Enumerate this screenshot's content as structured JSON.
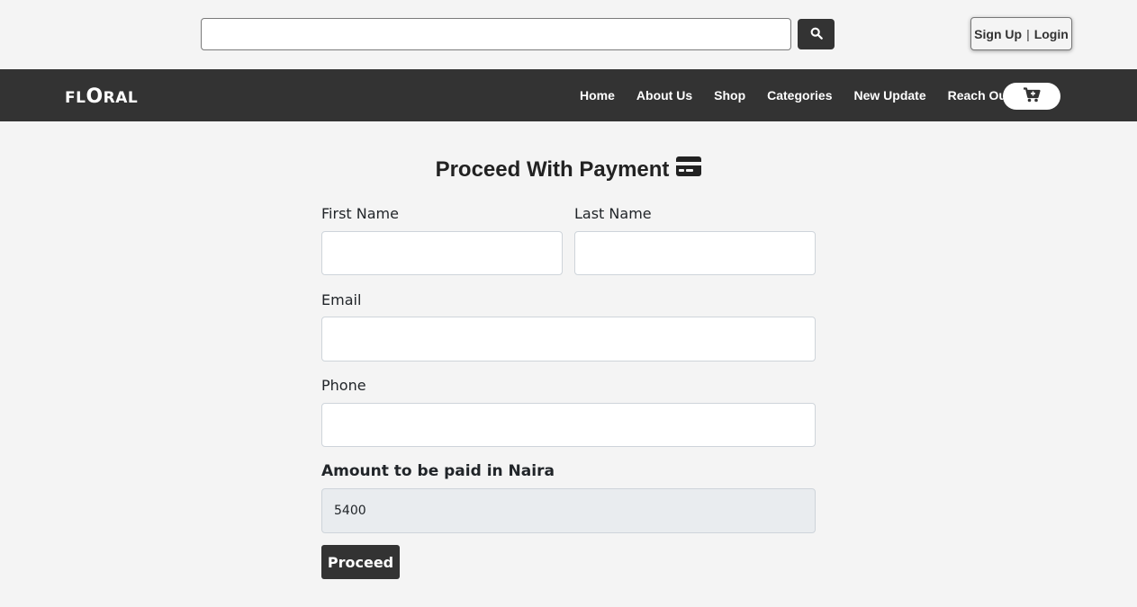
{
  "header": {
    "search": {
      "placeholder": "",
      "value": ""
    },
    "auth": {
      "signup_label": "Sign Up",
      "separator": "|",
      "login_label": "Login"
    }
  },
  "navbar": {
    "logo": {
      "part1": "FL",
      "part2": "O",
      "part3": "RAL"
    },
    "links": [
      {
        "label": "Home"
      },
      {
        "label": "About Us"
      },
      {
        "label": "Shop"
      },
      {
        "label": "Categories"
      },
      {
        "label": "New Update"
      },
      {
        "label": "Reach Out"
      }
    ],
    "cart_icon": "cart-plus-icon"
  },
  "form": {
    "title": "Proceed With Payment",
    "title_icon": "credit-card-icon",
    "first_name": {
      "label": "First Name",
      "value": ""
    },
    "last_name": {
      "label": "Last Name",
      "value": ""
    },
    "email": {
      "label": "Email",
      "value": ""
    },
    "phone": {
      "label": "Phone",
      "value": ""
    },
    "amount": {
      "label": "Amount to be paid in Naira",
      "value": "5400"
    },
    "submit_label": "Proceed"
  },
  "colors": {
    "background": "#f4f4f4",
    "navbar": "#333333",
    "button": "#333333",
    "readonly_field": "#e9ecef"
  }
}
